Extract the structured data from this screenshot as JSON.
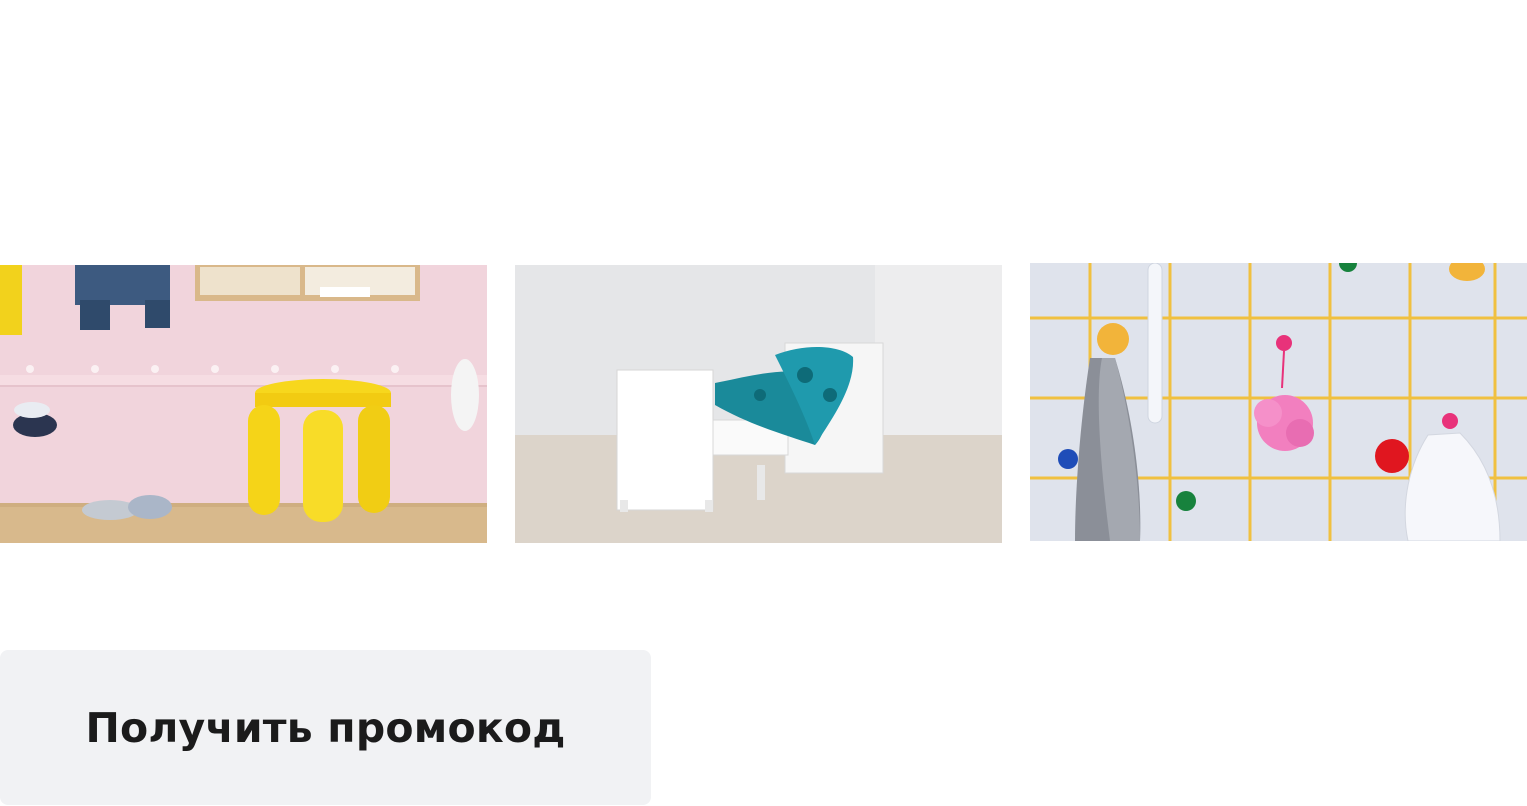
{
  "promo": {
    "button_label": "Получить промокод"
  },
  "photos": [
    {
      "icon": "kids-stool-hallway-image"
    },
    {
      "icon": "kids-bed-image"
    },
    {
      "icon": "bathroom-hooks-image"
    }
  ],
  "colors": {
    "button_bg": "#f1f2f4",
    "button_text": "#1b1b1b",
    "stool_yellow": "#f5d418",
    "pink_wall": "#f1d4dc",
    "teal_blanket": "#1a8a9a",
    "tile_grid": "#f0c040"
  }
}
